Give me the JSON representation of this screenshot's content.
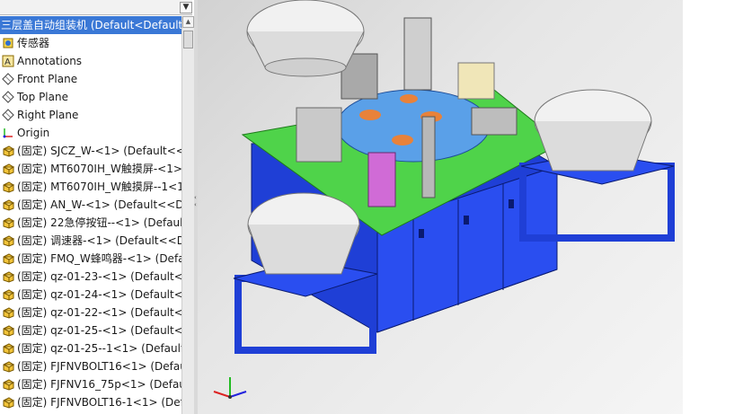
{
  "tree": {
    "items": [
      {
        "label": "三层盖自动组装机  (Default<Default",
        "icon": "assembly-icon",
        "selected": true
      },
      {
        "label": "传感器",
        "icon": "sensor-icon"
      },
      {
        "label": "Annotations",
        "icon": "annotation-icon"
      },
      {
        "label": "Front Plane",
        "icon": "plane-icon"
      },
      {
        "label": "Top Plane",
        "icon": "plane-icon"
      },
      {
        "label": "Right Plane",
        "icon": "plane-icon"
      },
      {
        "label": "Origin",
        "icon": "origin-icon"
      },
      {
        "label": "(固定) SJCZ_W-<1>  (Default<<D",
        "icon": "part-icon"
      },
      {
        "label": "(固定) MT6070IH_W触摸屏-<1>",
        "icon": "part-icon"
      },
      {
        "label": "(固定) MT6070IH_W触摸屏--1<1",
        "icon": "part-icon"
      },
      {
        "label": "(固定) AN_W-<1>  (Default<<De",
        "icon": "part-icon"
      },
      {
        "label": "(固定) 22急停按钮--<1>  (Default",
        "icon": "part-icon"
      },
      {
        "label": "(固定) 调速器-<1>  (Default<<De",
        "icon": "part-icon"
      },
      {
        "label": "(固定) FMQ_W蜂鸣器-<1>  (Defa",
        "icon": "part-icon"
      },
      {
        "label": "(固定) qz-01-23-<1>  (Default<<",
        "icon": "part-icon"
      },
      {
        "label": "(固定) qz-01-24-<1>  (Default<<",
        "icon": "part-icon"
      },
      {
        "label": "(固定) qz-01-22-<1>  (Default<<",
        "icon": "part-icon"
      },
      {
        "label": "(固定) qz-01-25-<1>  (Default<<",
        "icon": "part-icon"
      },
      {
        "label": "(固定) qz-01-25--1<1>  (Default-",
        "icon": "part-icon"
      },
      {
        "label": "(固定) FJFNVBOLT16<1>  (Defau",
        "icon": "part-icon"
      },
      {
        "label": "(固定) FJFNV16_75p<1>  (Defaul",
        "icon": "part-icon"
      },
      {
        "label": "(固定) FJFNVBOLT16-1<1>  (Def",
        "icon": "part-icon"
      }
    ]
  },
  "colors": {
    "frame": "#1f3fd6",
    "table_top": "#4fd34a",
    "bowl": "#e9e9e9",
    "selection": "#3a78d6"
  }
}
